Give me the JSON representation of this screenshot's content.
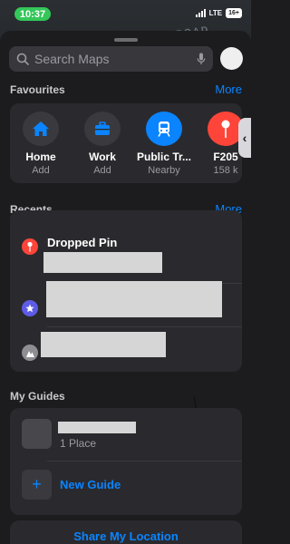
{
  "status_bar": {
    "time": "10:37",
    "network": "LTE",
    "battery": "16+"
  },
  "map": {
    "road_label": "ROAD"
  },
  "search": {
    "placeholder": "Search Maps"
  },
  "favourites": {
    "title": "Favourites",
    "more_label": "More",
    "items": [
      {
        "title": "Home",
        "subtitle": "Add",
        "icon": "house-icon",
        "color": "#0a84ff"
      },
      {
        "title": "Work",
        "subtitle": "Add",
        "icon": "briefcase-icon",
        "color": "#0a84ff"
      },
      {
        "title": "Public Tr...",
        "subtitle": "Nearby",
        "icon": "tram-icon",
        "color": "#ffffff"
      },
      {
        "title": "F205",
        "subtitle": "158 k",
        "icon": "pin-icon",
        "color": "#ffffff"
      }
    ]
  },
  "recents": {
    "title": "Recents",
    "more_label": "More",
    "items": [
      {
        "title": "Dropped Pin",
        "icon": "pin-icon",
        "color": "#ff453a"
      },
      {
        "title": "",
        "icon": "star-icon",
        "color": "#5e5ce6"
      },
      {
        "title": "",
        "icon": "landmark-icon",
        "color": "#8e8e93"
      }
    ]
  },
  "guides": {
    "title": "My Guides",
    "items": [
      {
        "count": "1 Place"
      }
    ],
    "new_label": "New Guide"
  },
  "share_location": {
    "label": "Share My Location"
  }
}
